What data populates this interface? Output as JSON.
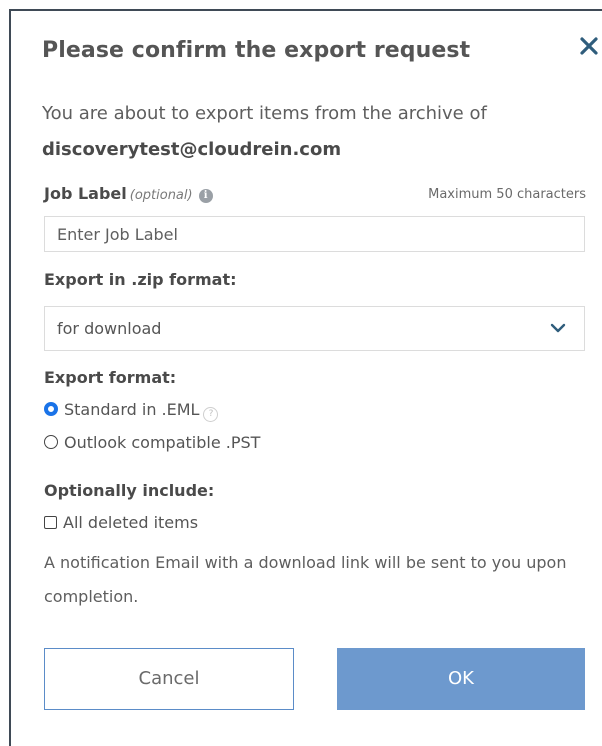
{
  "dialog": {
    "title": "Please confirm the export request",
    "close_icon": "close-icon",
    "intro_text": "You are about to export items from the archive of",
    "archive_email": "discoverytest@cloudrein.com"
  },
  "job_label": {
    "label": "Job Label",
    "optional": "(optional)",
    "info_icon": "info-icon",
    "max_hint": "Maximum 50 characters",
    "value": "",
    "placeholder": "Enter Job Label"
  },
  "zip": {
    "heading": "Export in .zip format:",
    "selected": "for download",
    "chevron_icon": "chevron-down-icon"
  },
  "format": {
    "heading": "Export format:",
    "options": [
      {
        "label": "Standard in .EML",
        "checked": true
      },
      {
        "label": "Outlook compatible .PST",
        "checked": false
      }
    ],
    "help_icon": "question-icon"
  },
  "include": {
    "heading": "Optionally include:",
    "deleted_label": "All deleted items",
    "deleted_checked": false
  },
  "notice": "A notification Email with a download link will be sent to you upon completion.",
  "buttons": {
    "cancel": "Cancel",
    "ok": "OK"
  },
  "colors": {
    "accent": "#1a73e8",
    "primary_button": "#6d99ce",
    "close_icon": "#2f5d7c"
  }
}
